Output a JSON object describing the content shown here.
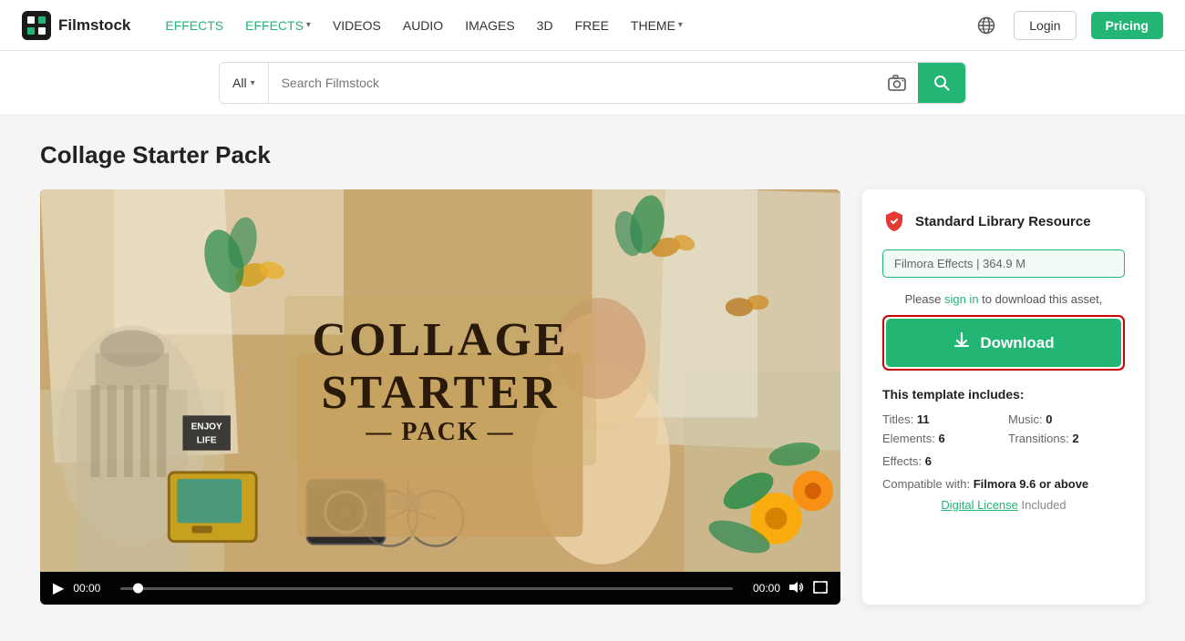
{
  "header": {
    "logo_text": "Filmstock",
    "nav_items": [
      {
        "label": "EFFECTS",
        "type": "active",
        "id": "effects1"
      },
      {
        "label": "EFFECTS",
        "type": "active-dropdown",
        "id": "effects2",
        "has_chevron": true
      },
      {
        "label": "VIDEOS",
        "type": "normal",
        "id": "videos"
      },
      {
        "label": "AUDIO",
        "type": "normal",
        "id": "audio"
      },
      {
        "label": "IMAGES",
        "type": "normal",
        "id": "images"
      },
      {
        "label": "3D",
        "type": "normal",
        "id": "3d"
      },
      {
        "label": "FREE",
        "type": "normal",
        "id": "free"
      },
      {
        "label": "THEME",
        "type": "normal-dropdown",
        "id": "theme",
        "has_chevron": true
      }
    ],
    "login_label": "Login",
    "pricing_label": "Pricing"
  },
  "search": {
    "category_label": "All",
    "placeholder": "Search Filmstock"
  },
  "page": {
    "title": "Collage Starter Pack"
  },
  "video": {
    "collage_title_line1": "COLLAGE",
    "collage_title_line2": "STARTER",
    "collage_title_line3": "PACK",
    "dash_line": "— PACK —",
    "enjoy_line1": "ENJOY",
    "enjoy_line2": "LIFE",
    "time_start": "00:00",
    "time_end": "00:00"
  },
  "sidebar": {
    "resource_title": "Standard Library Resource",
    "filmora_effects_label": "Filmora Effects",
    "file_size": "364.9 M",
    "sign_in_pre": "Please ",
    "sign_in_link": "sign in",
    "sign_in_post": " to download this asset,",
    "download_label": "Download",
    "template_includes_title": "This template includes:",
    "stats": [
      {
        "label": "Titles:",
        "value": "11",
        "id": "titles"
      },
      {
        "label": "Music:",
        "value": "0",
        "id": "music"
      },
      {
        "label": "Elements:",
        "value": "6",
        "id": "elements"
      },
      {
        "label": "Transitions:",
        "value": "2",
        "id": "transitions"
      }
    ],
    "effects_label": "Effects:",
    "effects_value": "6",
    "compatible_label": "Compatible with:",
    "compatible_value": "Filmora 9.6 or above",
    "digital_license_link": "Digital License",
    "digital_license_suffix": " Included"
  }
}
